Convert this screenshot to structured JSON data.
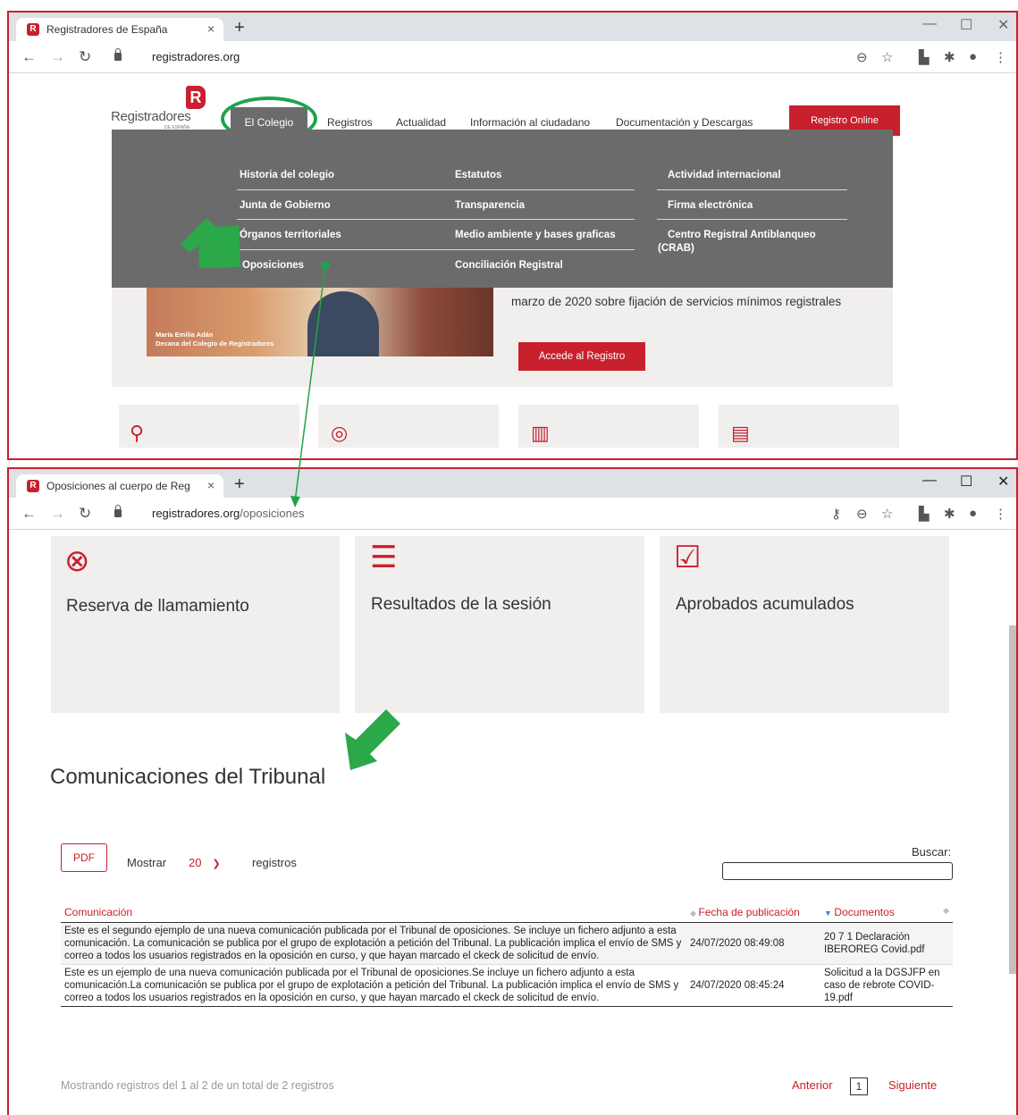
{
  "window1": {
    "tab_title": "Registradores de España",
    "url": "registradores.org",
    "logo": {
      "text": "Registradores",
      "sub": "DE ESPAÑA"
    },
    "nav": [
      "El Colegio",
      "Registros",
      "Actualidad",
      "Información al ciudadano",
      "Documentación y Descargas"
    ],
    "cta": "Registro Online",
    "dropdown": {
      "col1": [
        "Historia del colegio",
        "Junta de Gobierno",
        "Órganos territoriales",
        "Oposiciones"
      ],
      "col2": [
        "Estatutos",
        "Transparencia",
        "Medio ambiente y bases graficas",
        "Conciliación Registral"
      ],
      "col3": [
        "Actividad internacional",
        "Firma electrónica",
        "Centro Registral Antiblanqueo",
        "(CRAB)"
      ]
    },
    "hero": {
      "caption_name": "María Emilia Adán",
      "caption_role": "Decana del Colegio de Registradores",
      "text": "marzo de 2020 sobre fijación de servicios mínimos registrales",
      "button": "Accede al Registro"
    }
  },
  "window2": {
    "tab_title": "Oposiciones al cuerpo de Registr",
    "url_host": "registradores.org",
    "url_path": "/oposiciones",
    "cards": [
      {
        "title": "Reserva de llamamiento",
        "icon": "clock-cancel-icon"
      },
      {
        "title": "Resultados de la sesión",
        "icon": "list-icon"
      },
      {
        "title": "Aprobados acumulados",
        "icon": "hand-check-icon"
      }
    ],
    "section_title": "Comunicaciones del Tribunal",
    "pdf": "PDF",
    "show_label": "Mostrar",
    "show_value": "20",
    "records_label": "registros",
    "search_label": "Buscar:",
    "table": {
      "headers": [
        "Comunicación",
        "Fecha de publicación",
        "Documentos"
      ],
      "rows": [
        {
          "text": "Este es el segundo ejemplo de una nueva comunicación publicada por el Tribunal de oposiciones. Se incluye un fichero adjunto a esta comunicación. La comunicación se publica por el grupo de explotación a petición del Tribunal. La publicación implica el envío de SMS y correo a todos los usuarios registrados en la oposición en curso, y que hayan marcado el ckeck de solicitud de envío.",
          "date": "24/07/2020 08:49:08",
          "doc": "20 7 1 Declaración IBEROREG Covid.pdf"
        },
        {
          "text": "Este es un ejemplo de una nueva comunicación publicada por el Tribunal de oposiciones.Se incluye un fichero adjunto a esta comunicación.La comunicación se publica por el grupo de explotación a petición del Tribunal. La publicación implica el envío de SMS y correo a todos los usuarios registrados en la oposición en curso, y que hayan marcado el ckeck de solicitud de envío.",
          "date": "24/07/2020 08:45:24",
          "doc": "Solicitud a la DGSJFP en caso de rebrote COVID-19.pdf"
        }
      ]
    },
    "info": "Mostrando registros del 1 al 2 de un total de 2 registros",
    "prev": "Anterior",
    "page": "1",
    "next": "Siguiente"
  },
  "colors": {
    "brand": "#c8202d",
    "highlight": "#1fa34a",
    "menu_bg": "#6b6b6b"
  }
}
